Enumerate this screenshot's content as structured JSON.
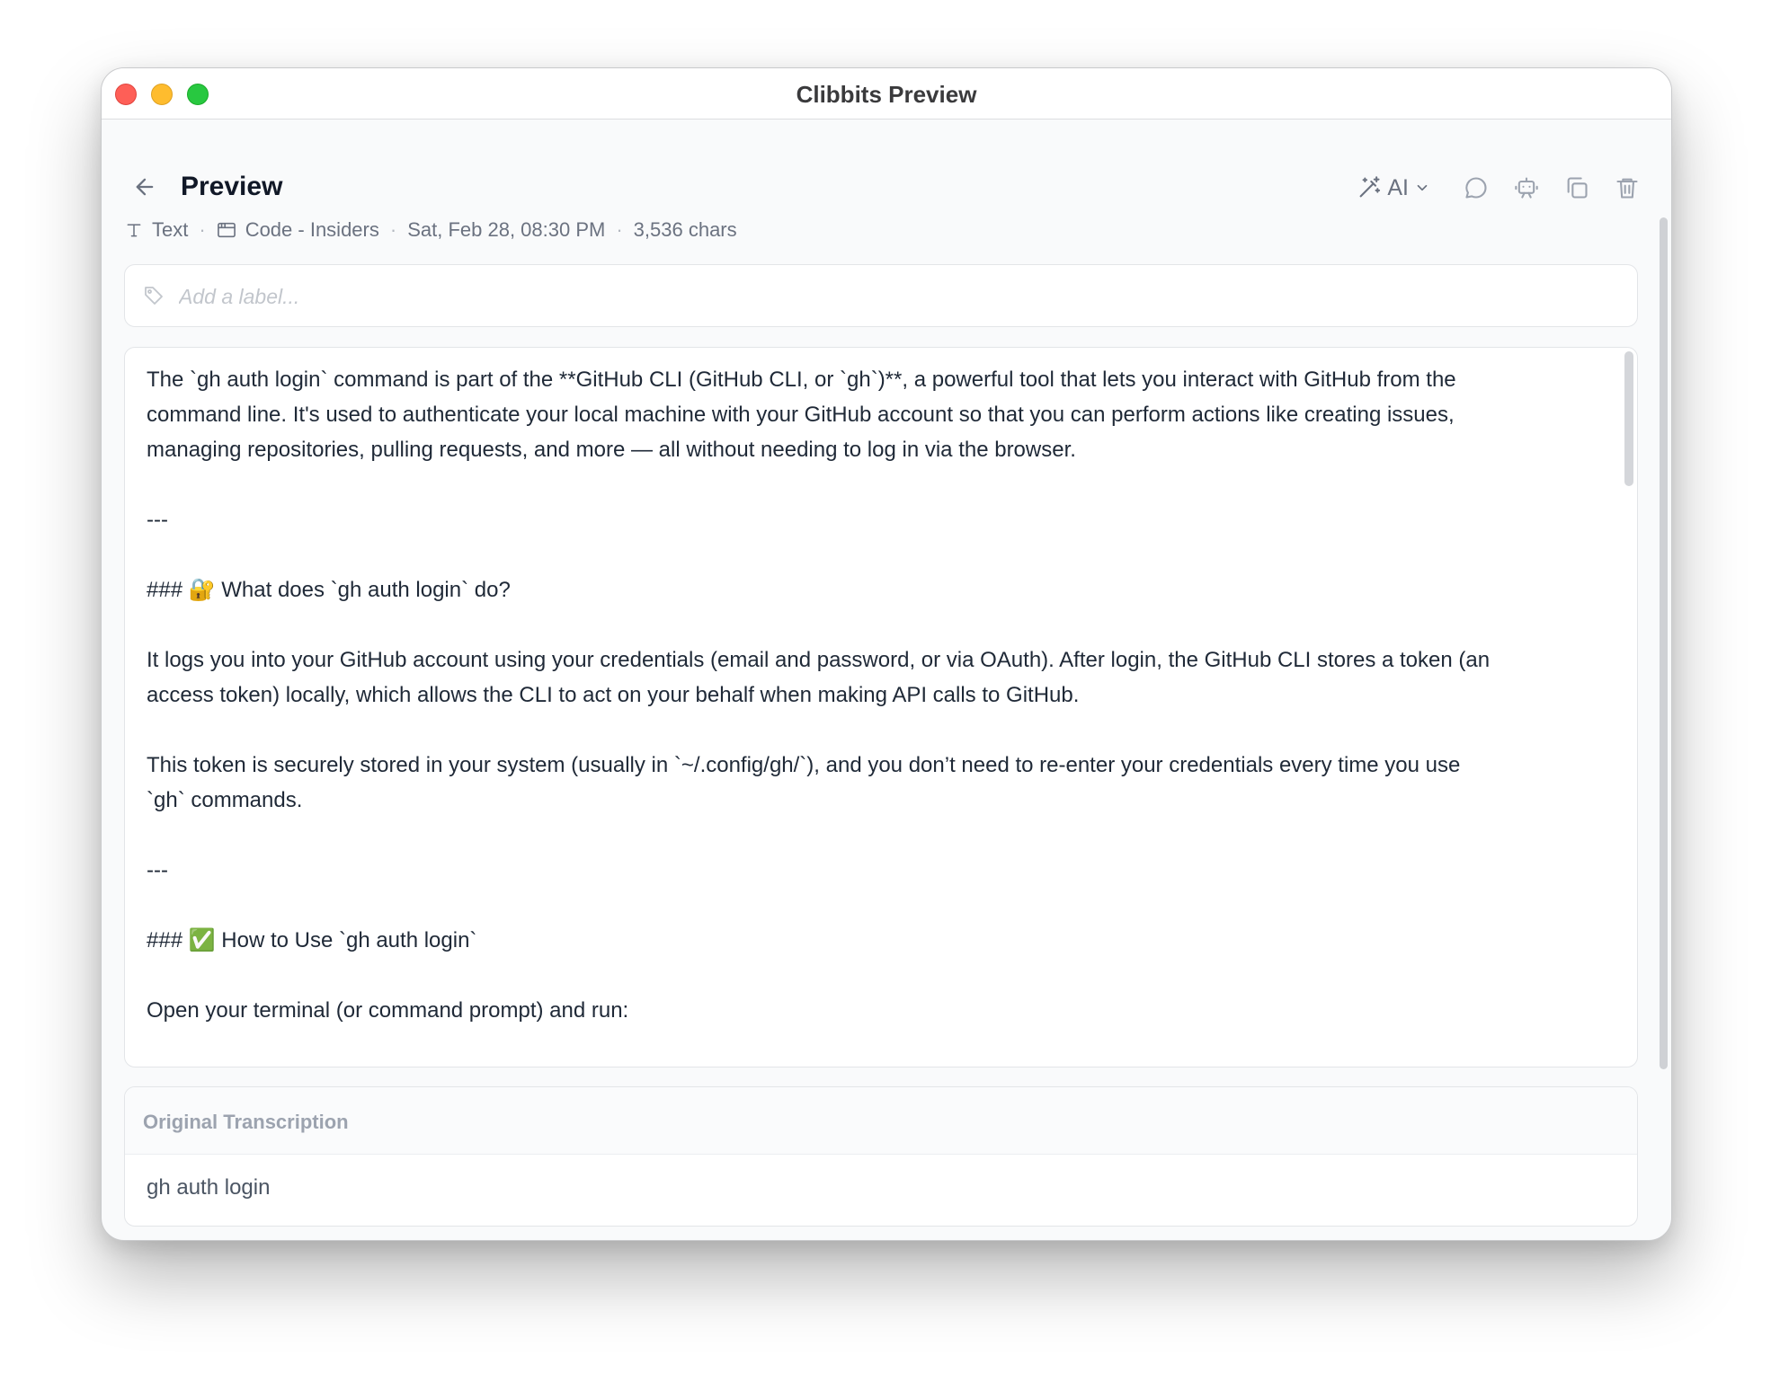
{
  "window": {
    "title": "Clibbits Preview"
  },
  "header": {
    "title": "Preview",
    "ai_label": "AI"
  },
  "meta": {
    "type": "Text",
    "app": "Code - Insiders",
    "date": "Sat, Feb 28, 08:30 PM",
    "chars": "3,536 chars",
    "separator": "·"
  },
  "label": {
    "placeholder": "Add a label...",
    "value": ""
  },
  "content": {
    "text": "The `gh auth login` command is part of the **GitHub CLI (GitHub CLI, or `gh`)**, a powerful tool that lets you interact with GitHub from the\ncommand line. It's used to authenticate your local machine with your GitHub account so that you can perform actions like creating issues,\nmanaging repositories, pulling requests, and more — all without needing to log in via the browser.\n\n---\n\n### 🔐 What does `gh auth login` do?\n\nIt logs you into your GitHub account using your credentials (email and password, or via OAuth). After login, the GitHub CLI stores a token (an\naccess token) locally, which allows the CLI to act on your behalf when making API calls to GitHub.\n\nThis token is securely stored in your system (usually in `~/.config/gh/`), and you don’t need to re-enter your credentials every time you use\n`gh` commands.\n\n---\n\n### ✅ How to Use `gh auth login`\n\nOpen your terminal (or command prompt) and run:"
  },
  "original": {
    "title": "Original Transcription",
    "text": "gh auth login"
  },
  "icons": {
    "back": "arrow-left-icon",
    "ai": "magic-wand-icon",
    "chevron": "chevron-down-icon",
    "comment": "chat-bubble-icon",
    "bot": "bot-icon",
    "copy": "copy-icon",
    "delete": "trash-icon",
    "type": "text-type-icon",
    "app": "app-window-icon",
    "tag": "tag-icon"
  },
  "colors": {
    "close": "#fe5f57",
    "minimize": "#febc2e",
    "maximize": "#28c840",
    "icon": "#9ca3af"
  }
}
